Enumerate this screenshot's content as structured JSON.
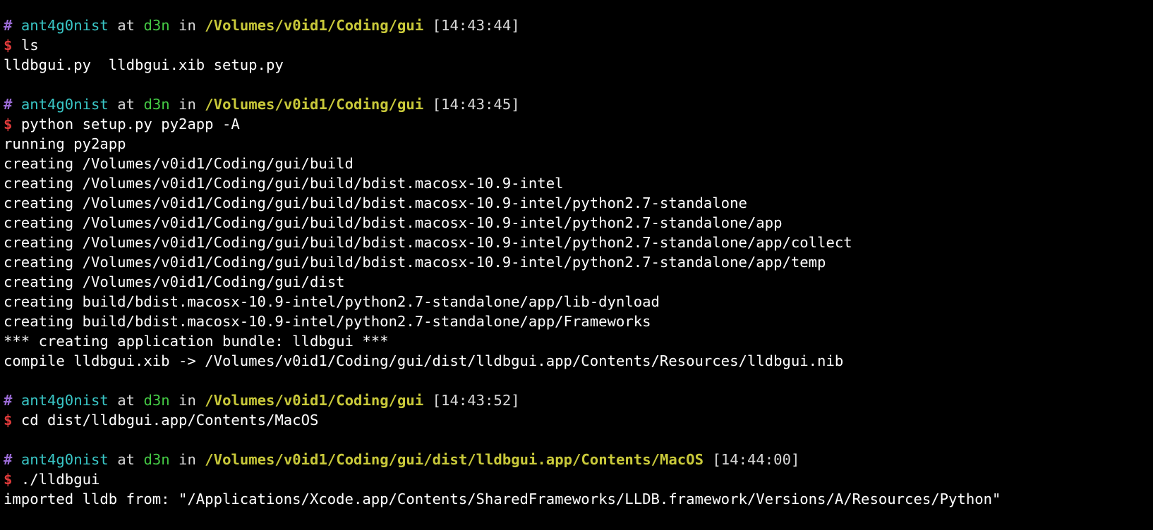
{
  "terminal": {
    "blocks": [
      {
        "prompt": {
          "hash": "#",
          "user": "ant4g0nist",
          "at": "at",
          "host": "d3n",
          "in": "in",
          "path": "/Volumes/v0id1/Coding/gui",
          "time": "[14:43:44]"
        },
        "command": "ls",
        "output": [
          "lldbgui.py  lldbgui.xib setup.py"
        ]
      },
      {
        "prompt": {
          "hash": "#",
          "user": "ant4g0nist",
          "at": "at",
          "host": "d3n",
          "in": "in",
          "path": "/Volumes/v0id1/Coding/gui",
          "time": "[14:43:45]"
        },
        "command": "python setup.py py2app -A",
        "output": [
          "running py2app",
          "creating /Volumes/v0id1/Coding/gui/build",
          "creating /Volumes/v0id1/Coding/gui/build/bdist.macosx-10.9-intel",
          "creating /Volumes/v0id1/Coding/gui/build/bdist.macosx-10.9-intel/python2.7-standalone",
          "creating /Volumes/v0id1/Coding/gui/build/bdist.macosx-10.9-intel/python2.7-standalone/app",
          "creating /Volumes/v0id1/Coding/gui/build/bdist.macosx-10.9-intel/python2.7-standalone/app/collect",
          "creating /Volumes/v0id1/Coding/gui/build/bdist.macosx-10.9-intel/python2.7-standalone/app/temp",
          "creating /Volumes/v0id1/Coding/gui/dist",
          "creating build/bdist.macosx-10.9-intel/python2.7-standalone/app/lib-dynload",
          "creating build/bdist.macosx-10.9-intel/python2.7-standalone/app/Frameworks",
          "*** creating application bundle: lldbgui ***",
          "compile lldbgui.xib -> /Volumes/v0id1/Coding/gui/dist/lldbgui.app/Contents/Resources/lldbgui.nib"
        ]
      },
      {
        "prompt": {
          "hash": "#",
          "user": "ant4g0nist",
          "at": "at",
          "host": "d3n",
          "in": "in",
          "path": "/Volumes/v0id1/Coding/gui",
          "time": "[14:43:52]"
        },
        "command": "cd dist/lldbgui.app/Contents/MacOS",
        "output": []
      },
      {
        "prompt": {
          "hash": "#",
          "user": "ant4g0nist",
          "at": "at",
          "host": "d3n",
          "in": "in",
          "path": "/Volumes/v0id1/Coding/gui/dist/lldbgui.app/Contents/MacOS",
          "time": "[14:44:00]"
        },
        "command": "./lldbgui",
        "output": [
          "imported lldb from: \"/Applications/Xcode.app/Contents/SharedFrameworks/LLDB.framework/Versions/A/Resources/Python\""
        ]
      }
    ],
    "dollar": "$"
  }
}
